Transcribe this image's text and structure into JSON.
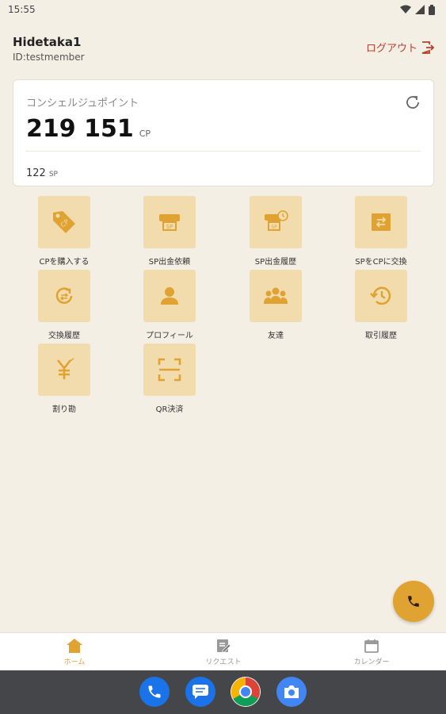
{
  "status_bar": {
    "time": "15:55"
  },
  "user": {
    "name": "Hidetaka1",
    "id": "ID:testmember"
  },
  "header": {
    "logout_label": "ログアウト"
  },
  "points_card": {
    "label": "コンシェルジュポイント",
    "cp_value": "219 151",
    "cp_unit": "CP",
    "sp_value": "122",
    "sp_unit": "SP"
  },
  "menu": [
    {
      "label": "CPを購入する",
      "icon": "cp-tag-icon"
    },
    {
      "label": "SP出金依頼",
      "icon": "sp-withdraw-icon"
    },
    {
      "label": "SP出金履歴",
      "icon": "sp-history-icon"
    },
    {
      "label": "SPをCPに交換",
      "icon": "exchange-icon"
    },
    {
      "label": "交換履歴",
      "icon": "exchange-history-icon"
    },
    {
      "label": "プロフィール",
      "icon": "person-icon"
    },
    {
      "label": "友達",
      "icon": "friends-icon"
    },
    {
      "label": "取引履歴",
      "icon": "history-icon"
    },
    {
      "label": "割り勘",
      "icon": "yen-split-icon"
    },
    {
      "label": "QR決済",
      "icon": "qr-scan-icon"
    }
  ],
  "bottom_nav": [
    {
      "label": "ホーム",
      "icon": "home-icon",
      "active": true
    },
    {
      "label": "リクエスト",
      "icon": "request-icon",
      "active": false
    },
    {
      "label": "カレンダー",
      "icon": "calendar-icon",
      "active": false
    }
  ],
  "colors": {
    "accent": "#e0a332",
    "tile": "#f2dcae",
    "background": "#f4efe4",
    "logout": "#b8402c"
  }
}
